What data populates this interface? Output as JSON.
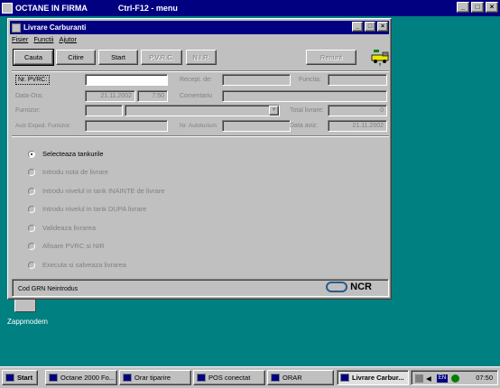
{
  "outer": {
    "title": "OCTANE IN FIRMA",
    "shortcut_menu": "Ctrl-F12 - menu"
  },
  "window": {
    "title": "Livrare Carburanti",
    "menu": [
      "Fisier",
      "Functii",
      "Ajutor"
    ]
  },
  "toolbar": {
    "cauta": "Cauta",
    "citire": "Citire",
    "start": "Start",
    "pvrc": "P.V.R.C.",
    "nir": "N.I.R.",
    "renunt": "Renunt"
  },
  "form": {
    "nr_pvrc_label": "Nr. PVRC:",
    "nr_pvrc_value": "",
    "recept_de_label": "Recept. de:",
    "functia_label": "Functia:",
    "data_ora_label": "Data-Ora:",
    "date_value": "21.11.2002",
    "time_value": "7:50",
    "comentariu_label": "Comentariu",
    "furnizor_label": "Furnizor:",
    "total_livrare_label": "Total livrare:",
    "total_livrare_value": "0",
    "aviz_label": "Aviz Exped. Furnizor:",
    "nr_autoturism_label": "Nr. Autoturism:",
    "data_aviz_label": "Data aviz:",
    "data_aviz_value": "21.11.2002"
  },
  "steps": [
    "Selecteaza tankurile",
    "Introdu nota de livrare",
    "Introdu nivelul in tank INAINTE de livrare",
    "Introdu nivelul in tank DUPA livrare",
    "Valideaza livrarea",
    "Afisare PVRC si NIR",
    "Executa si salveaza livrarea"
  ],
  "active_step_index": 0,
  "status": {
    "cod_grn": "Cod GRN  Neintrodus",
    "brand": "NCR"
  },
  "desktop": {
    "zappmodem": "Zappmodem"
  },
  "taskbar": {
    "start": "Start",
    "tasks": [
      "Octane 2000 Fo...",
      "Orar tiparire",
      "POS conectat",
      "ORAR",
      "Livrare Carbur..."
    ],
    "lang": "EN",
    "time": "07:50"
  },
  "colors": {
    "title_bar": "#000080",
    "face": "#c0c0c0",
    "desktop": "#008080"
  }
}
